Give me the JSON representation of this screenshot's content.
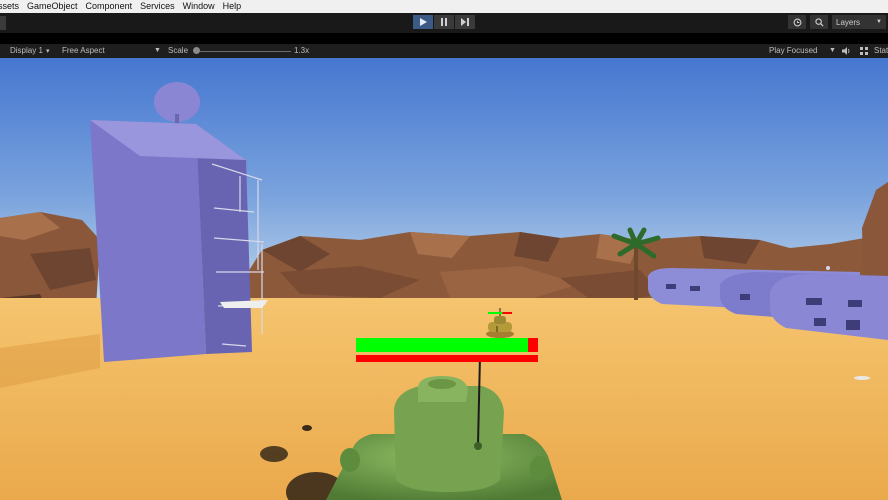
{
  "menu": {
    "items": [
      "ssets",
      "GameObject",
      "Component",
      "Services",
      "Window",
      "Help"
    ]
  },
  "toolbar": {
    "play_icon": "play-icon",
    "pause_icon": "pause-icon",
    "step_icon": "step-icon",
    "history_icon": "history-icon",
    "search_icon": "search-icon",
    "layers_label": "Layers"
  },
  "game_view": {
    "display": "Display 1",
    "aspect": "Free Aspect",
    "scale_label": "Scale",
    "scale_value": "1.3x",
    "play_focused": "Play Focused",
    "mute_icon": "speaker-icon",
    "stats_label": "Stat"
  },
  "hud": {
    "player_health_fraction": 0.945,
    "enemy_health_fraction": 1.0,
    "health_color": "#00ff00",
    "damage_color": "#ff0000"
  },
  "colors": {
    "sky_top": "#4a7bd4",
    "sky_bottom": "#b8d2ea",
    "sand": "#f0b35a",
    "cliff": "#8b5a3c",
    "building": "#7c77c9",
    "tank": "#79a552",
    "play_active": "#3b5b86"
  }
}
